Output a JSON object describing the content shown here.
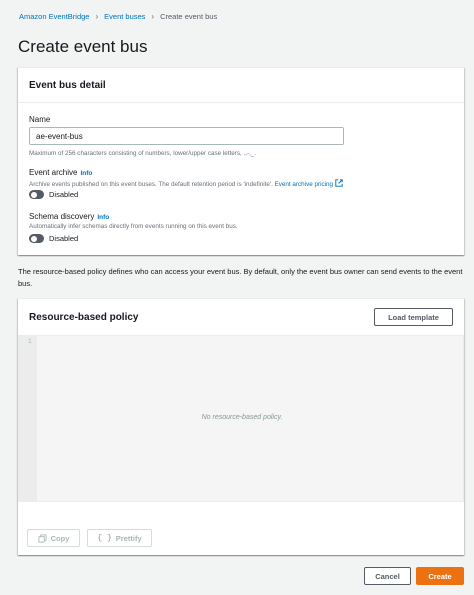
{
  "breadcrumb": {
    "items": [
      "Amazon EventBridge",
      "Event buses"
    ],
    "current": "Create event bus"
  },
  "page": {
    "title": "Create event bus"
  },
  "detail_panel": {
    "title": "Event bus detail",
    "name_label": "Name",
    "name_value": "ae-event-bus",
    "name_hint": "Maximum of 256 characters consisting of numbers, lower/upper case letters, .,-,_.",
    "archive_label": "Event archive",
    "archive_info": "Info",
    "archive_desc": "Archive events published on this event buses. The default retention period is 'indefinite'.",
    "archive_pricing_link": "Event archive pricing",
    "archive_toggle": "Disabled",
    "schema_label": "Schema discovery",
    "schema_info": "Info",
    "schema_desc": "Automatically infer schemas directly from events running on this event bus.",
    "schema_toggle": "Disabled"
  },
  "policy_note": "The resource-based policy defines who can access your event bus. By default, only the event bus owner can send events to the event bus.",
  "policy_panel": {
    "title": "Resource-based policy",
    "load_template": "Load template",
    "line_number": "1",
    "empty_text": "No resource-based policy.",
    "copy": "Copy",
    "prettify": "Prettify"
  },
  "footer": {
    "cancel": "Cancel",
    "create": "Create"
  },
  "colors": {
    "link": "#0073bb",
    "primary": "#ec7211",
    "background": "#f2f3f3",
    "toggle_off": "#545b64"
  },
  "icons": {
    "separator": "chevron-right-icon",
    "external": "external-link-icon",
    "copy": "copy-icon",
    "prettify": "braces-icon"
  }
}
